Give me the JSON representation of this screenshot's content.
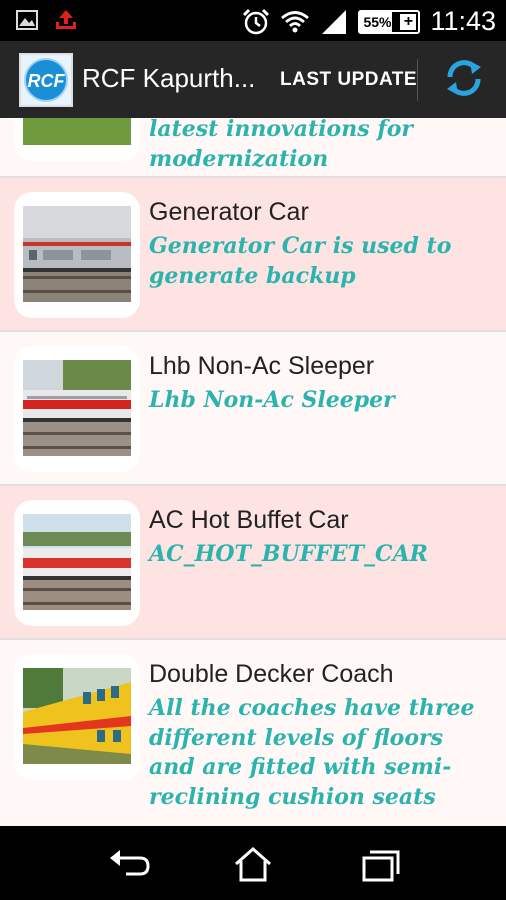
{
  "status_bar": {
    "time": "11:43",
    "battery_percent_label": "55%",
    "battery_level": 0.55,
    "icons": [
      "image-icon",
      "upload-icon",
      "alarm-icon",
      "wifi-icon",
      "signal-icon",
      "battery-icon"
    ]
  },
  "action_bar": {
    "app_title": "RCF Kapurth...",
    "logo_text": "RCF",
    "last_update_label": "LAST UPDATE",
    "refresh_icon": "refresh-icon"
  },
  "items": [
    {
      "title": "",
      "description": "latest innovations for modernization",
      "thumbnail": "train-on-grass"
    },
    {
      "title": "Generator Car",
      "description": "Generator Car is used to generate backup",
      "thumbnail": "generator-car-photo"
    },
    {
      "title": "Lhb Non-Ac Sleeper",
      "description": "Lhb Non-Ac Sleeper",
      "thumbnail": "sleeper-coach-photo"
    },
    {
      "title": "AC Hot Buffet Car",
      "description": "AC_HOT_BUFFET_CAR",
      "thumbnail": "buffet-car-photo"
    },
    {
      "title": "Double Decker Coach",
      "description": "All the coaches have three different levels of floors and are fitted with semi-reclining cushion seats",
      "thumbnail": "double-decker-photo"
    }
  ],
  "nav_bar": {
    "icons": [
      "back-icon",
      "home-icon",
      "recent-apps-icon"
    ]
  },
  "colors": {
    "status_bar_bg": "#000000",
    "action_bar_bg": "#262626",
    "item_pink_bg": "#fde4e3",
    "item_white_bg": "#fff8f7",
    "description_teal": "#2bb3ad",
    "refresh_blue": "#2aa4e0"
  }
}
